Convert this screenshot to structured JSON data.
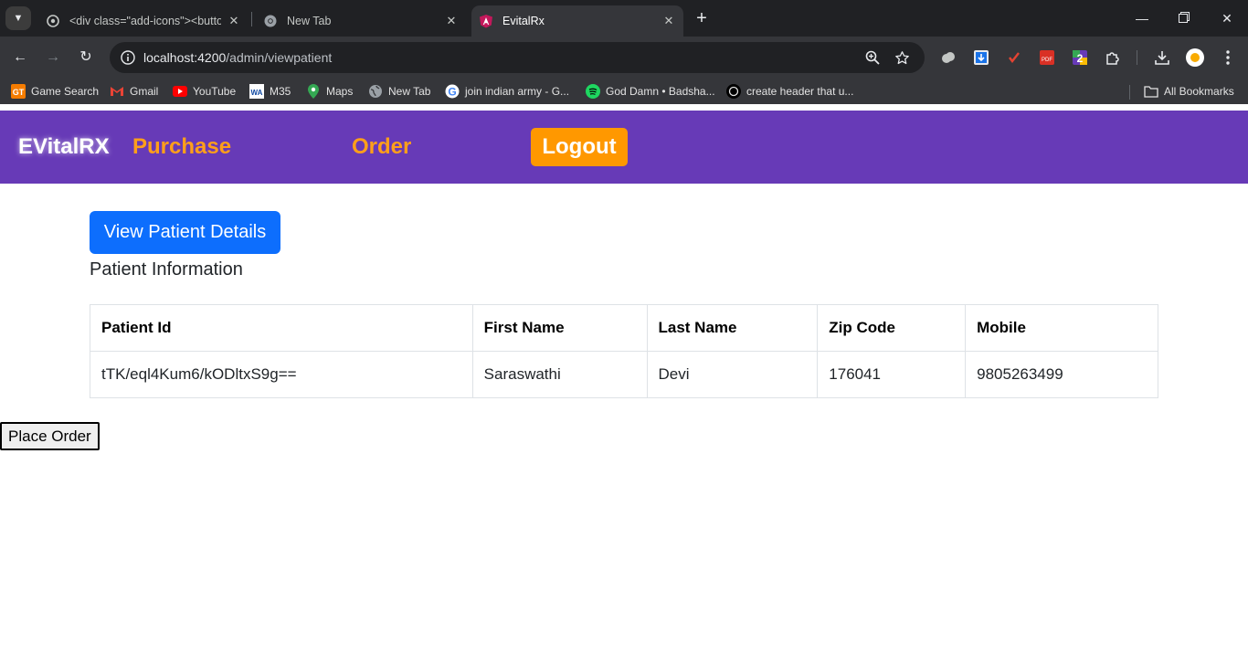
{
  "browser": {
    "tabs": [
      {
        "title": "<div class=\"add-icons\"><button",
        "favicon": "chatgpt-icon",
        "active": false
      },
      {
        "title": "New Tab",
        "favicon": "chrome-icon",
        "active": false
      },
      {
        "title": "EvitalRx",
        "favicon": "angular-icon",
        "active": true
      }
    ],
    "url_host": "localhost:4200",
    "url_path": "/admin/viewpatient",
    "bookmarks": [
      {
        "label": "Game Search",
        "icon": "gt-icon"
      },
      {
        "label": "Gmail",
        "icon": "gmail-icon"
      },
      {
        "label": "YouTube",
        "icon": "youtube-icon"
      },
      {
        "label": "M35",
        "icon": "wa-icon"
      },
      {
        "label": "Maps",
        "icon": "maps-icon"
      },
      {
        "label": "New Tab",
        "icon": "globe-icon"
      },
      {
        "label": "join indian army - G...",
        "icon": "google-icon"
      },
      {
        "label": "God Damn • Badsha...",
        "icon": "spotify-icon"
      },
      {
        "label": "create header that u...",
        "icon": "chatgpt-icon"
      }
    ],
    "all_bookmarks_label": "All Bookmarks"
  },
  "app": {
    "brand": "EVitalRX",
    "nav": {
      "purchase": "Purchase",
      "order": "Order",
      "logout": "Logout"
    },
    "view_button": "View Patient Details",
    "section_title": "Patient Information",
    "table": {
      "headers": [
        "Patient Id",
        "First Name",
        "Last Name",
        "Zip Code",
        "Mobile"
      ],
      "rows": [
        [
          "tTK/eql4Kum6/kODltxS9g==",
          "Saraswathi",
          "Devi",
          "176041",
          "9805263499"
        ]
      ]
    },
    "place_order": "Place Order"
  },
  "colors": {
    "navbar": "#673ab7",
    "nav_link": "#ff9f1a",
    "logout_bg": "#ff9800",
    "primary_button": "#0d6efd"
  }
}
